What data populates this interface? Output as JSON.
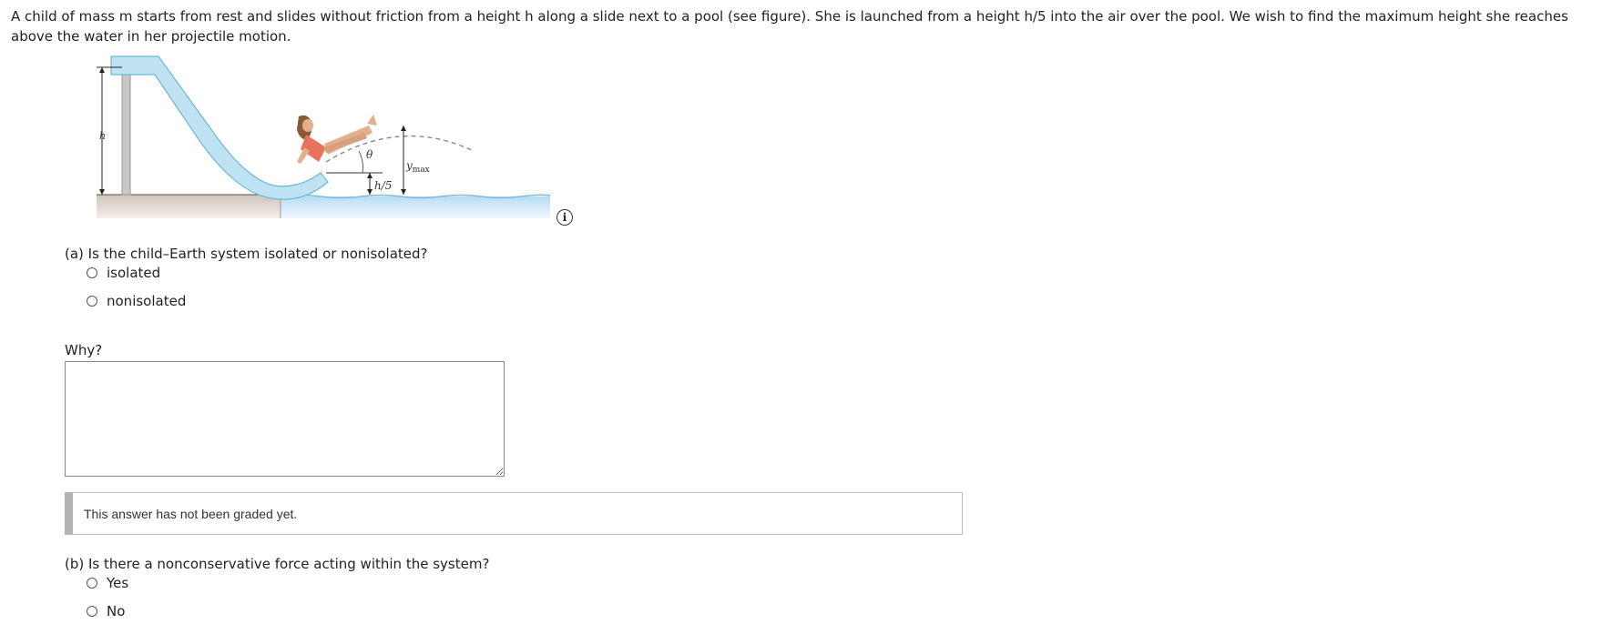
{
  "problem": {
    "text": "A child of mass m starts from rest and slides without friction from a height h along a slide next to a pool (see figure). She is launched from a height h/5 into the air over the pool. We wish to find the maximum height she reaches above the water in her projectile motion."
  },
  "figure": {
    "label_h": "h",
    "label_theta": "θ",
    "label_h5": "h/5",
    "label_ymax": "y",
    "label_ymax_sub": "max"
  },
  "part_a": {
    "question": "(a) Is the child–Earth system isolated or nonisolated?",
    "options": [
      "isolated",
      "nonisolated"
    ],
    "why_label": "Why?",
    "why_value": "",
    "grade_status": "This answer has not been graded yet."
  },
  "part_b": {
    "question": "(b) Is there a nonconservative force acting within the system?",
    "options": [
      "Yes",
      "No"
    ]
  },
  "colors": {
    "slide": "#bfe3f2",
    "slide_stroke": "#6bb8d6",
    "water": "#d6ecfa",
    "ground": "#d9cfc6"
  }
}
